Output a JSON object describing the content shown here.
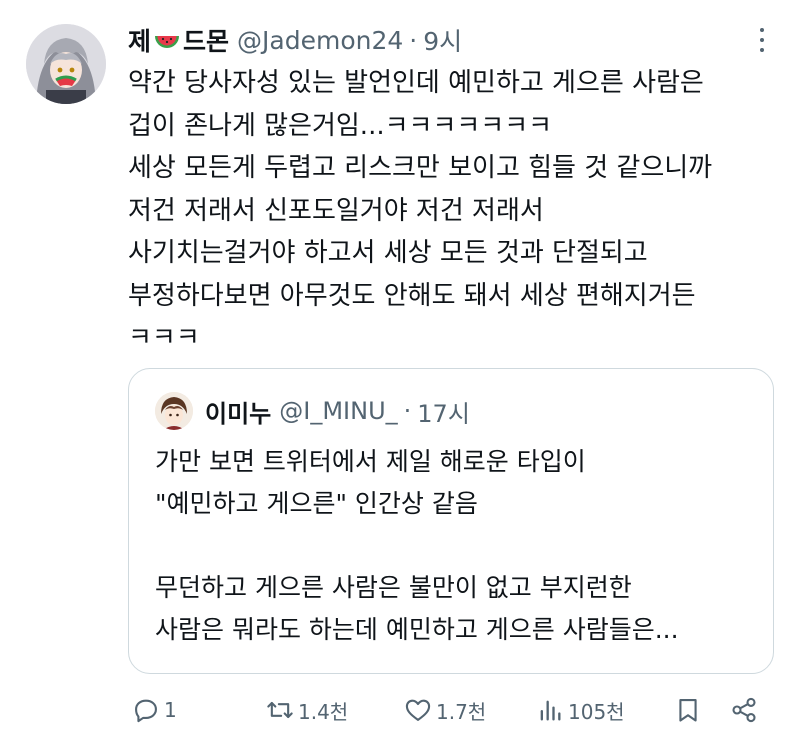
{
  "tweet": {
    "author": {
      "name_prefix": "제",
      "name_suffix": "드몬",
      "name_emoji": "watermelon-icon",
      "handle": "@Jademon24",
      "separator": "·",
      "time": "9시"
    },
    "lines": [
      "약간 당사자성 있는 발언인데 예민하고 게으른 사람은",
      "겁이 존나게 많은거임...ㅋㅋㅋㅋㅋㅋㅋ",
      "세상 모든게 두렵고 리스크만 보이고 힘들 것 같으니까",
      "저건 저래서 신포도일거야 저건 저래서",
      "사기치는걸거야 하고서 세상 모든 것과 단절되고",
      "부정하다보면 아무것도 안해도 돼서 세상 편해지거든",
      "ㅋㅋㅋ"
    ]
  },
  "quote": {
    "author": {
      "name": "이미누",
      "handle": "@I_MINU_",
      "separator": "·",
      "time": "17시"
    },
    "lines": [
      "가만 보면 트위터에서 제일 해로운 타입이",
      "\"예민하고 게으른\" 인간상 같음",
      "",
      "무던하고 게으른 사람은 불만이 없고 부지런한",
      "사람은 뭐라도 하는데 예민하고 게으른 사람들은..."
    ]
  },
  "actions": {
    "reply": {
      "icon": "reply-icon",
      "count": "1"
    },
    "retweet": {
      "icon": "retweet-icon",
      "count": "1.4천"
    },
    "like": {
      "icon": "heart-icon",
      "count": "1.7천"
    },
    "views": {
      "icon": "views-icon",
      "count": "105천"
    },
    "bookmark": {
      "icon": "bookmark-icon"
    },
    "share": {
      "icon": "share-icon"
    }
  },
  "colors": {
    "text": "#0f1419",
    "secondary": "#536471",
    "border": "#cfd9de",
    "background": "#ffffff"
  }
}
